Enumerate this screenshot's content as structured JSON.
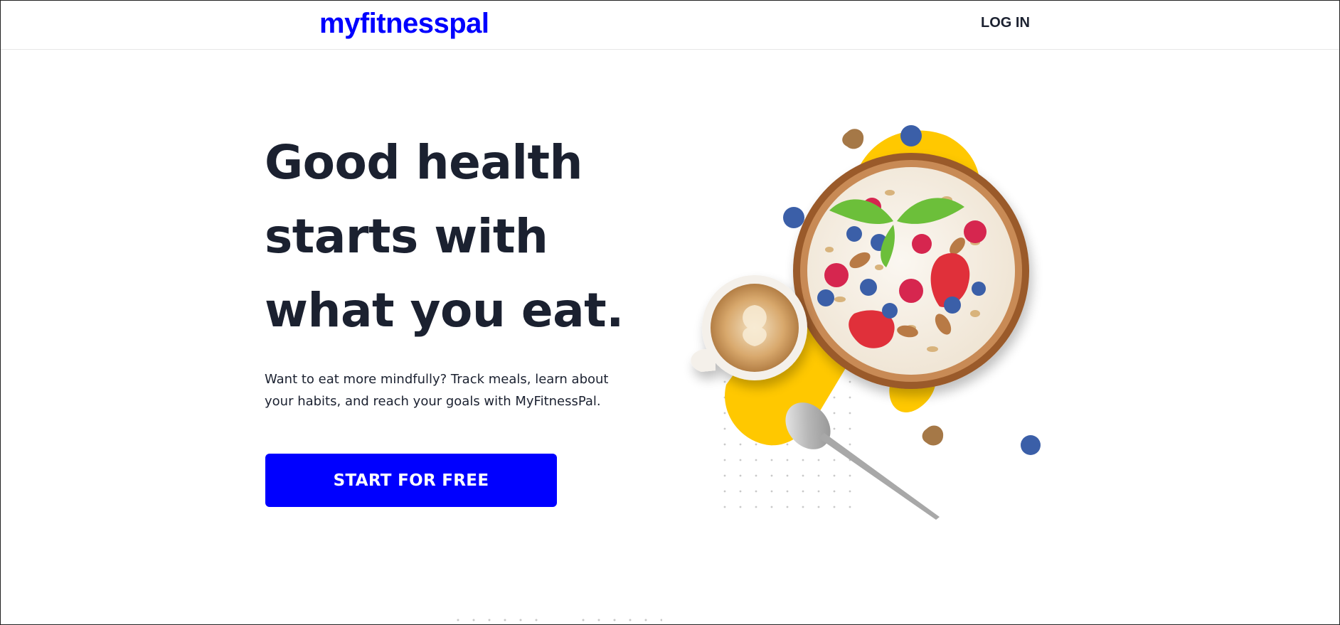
{
  "header": {
    "logo_text": "myfitnesspal",
    "login_label": "LOG IN"
  },
  "hero": {
    "title_lines": [
      "Good health",
      "starts with",
      "what you eat."
    ],
    "subtitle_lines": [
      "Want to eat more mindfully? Track meals, learn about",
      "your habits, and reach your goals with MyFitnessPal."
    ],
    "cta_label": "START FOR FREE"
  },
  "colors": {
    "brand_blue": "#0000ff",
    "heading": "#1b2130",
    "accent_yellow": "#ffc800"
  },
  "hero_image": {
    "icon": "breakfast-bowl-illustration"
  }
}
